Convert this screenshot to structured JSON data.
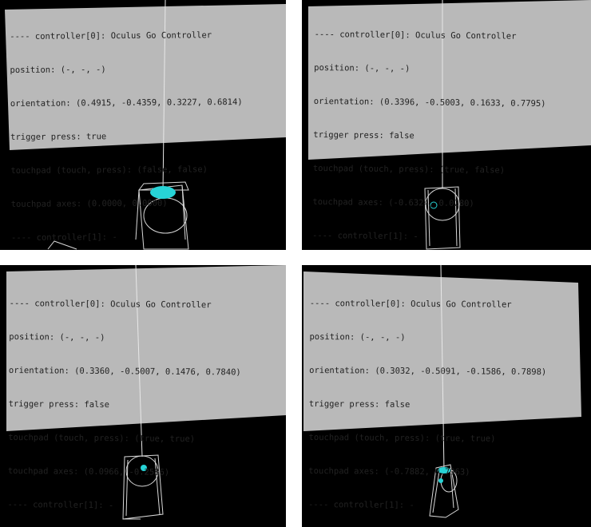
{
  "colors": {
    "background": "#000000",
    "screen": "#b9b9b9",
    "text": "#222222",
    "wireframe": "#d8d8d8",
    "touch_highlight": "#27d3d6",
    "gap": "#ffffff"
  },
  "panels": [
    {
      "lines": [
        "---- controller[0]: Oculus Go Controller",
        "position: (-, -, -)",
        "orientation: (0.4915, -0.4359, 0.3227, 0.6814)",
        "trigger press: true",
        "touchpad (touch, press): (false, false)",
        "touchpad axes: (0.0000, 0.0000)",
        "---- controller[1]: -"
      ],
      "touch_indicator": "trigger-highlight"
    },
    {
      "lines": [
        "---- controller[0]: Oculus Go Controller",
        "position: (-, -, -)",
        "orientation: (0.3396, -0.5003, 0.1633, 0.7795)",
        "trigger press: false",
        "touchpad (touch, press): (true, false)",
        "touchpad axes: (-0.6324, 0.0280)",
        "---- controller[1]: -"
      ],
      "touch_indicator": "touch-ring"
    },
    {
      "lines": [
        "---- controller[0]: Oculus Go Controller",
        "position: (-, -, -)",
        "orientation: (0.3360, -0.5007, 0.1476, 0.7840)",
        "trigger press: false",
        "touchpad (touch, press): (true, true)",
        "touchpad axes: (0.0966, -0.2586)",
        "---- controller[1]: -"
      ],
      "touch_indicator": "touch-dot"
    },
    {
      "lines": [
        "---- controller[0]: Oculus Go Controller",
        "position: (-, -, -)",
        "orientation: (0.3032, -0.5091, -0.1586, 0.7898)",
        "trigger press: false",
        "touchpad (touch, press): (true, true)",
        "touchpad axes: (-0.7882, 0.7963)",
        "---- controller[1]: -"
      ],
      "touch_indicator": "touch-dot-and-trigger"
    }
  ]
}
